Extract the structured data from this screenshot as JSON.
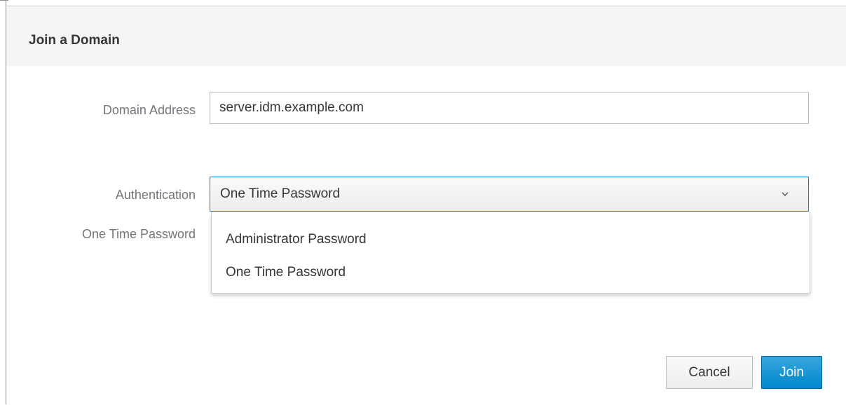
{
  "dialog": {
    "title": "Join a Domain"
  },
  "form": {
    "domain_address": {
      "label": "Domain Address",
      "value": "server.idm.example.com"
    },
    "authentication": {
      "label": "Authentication",
      "selected": "One Time Password",
      "icon": "chevron-down-icon",
      "options": [
        "Administrator Password",
        "One Time Password"
      ]
    },
    "one_time_password": {
      "label": "One Time Password"
    }
  },
  "buttons": {
    "cancel_label": "Cancel",
    "join_label": "Join"
  },
  "colors": {
    "primary": "#0088ce",
    "header_bg": "#f5f5f5",
    "label_text": "#72767b"
  }
}
